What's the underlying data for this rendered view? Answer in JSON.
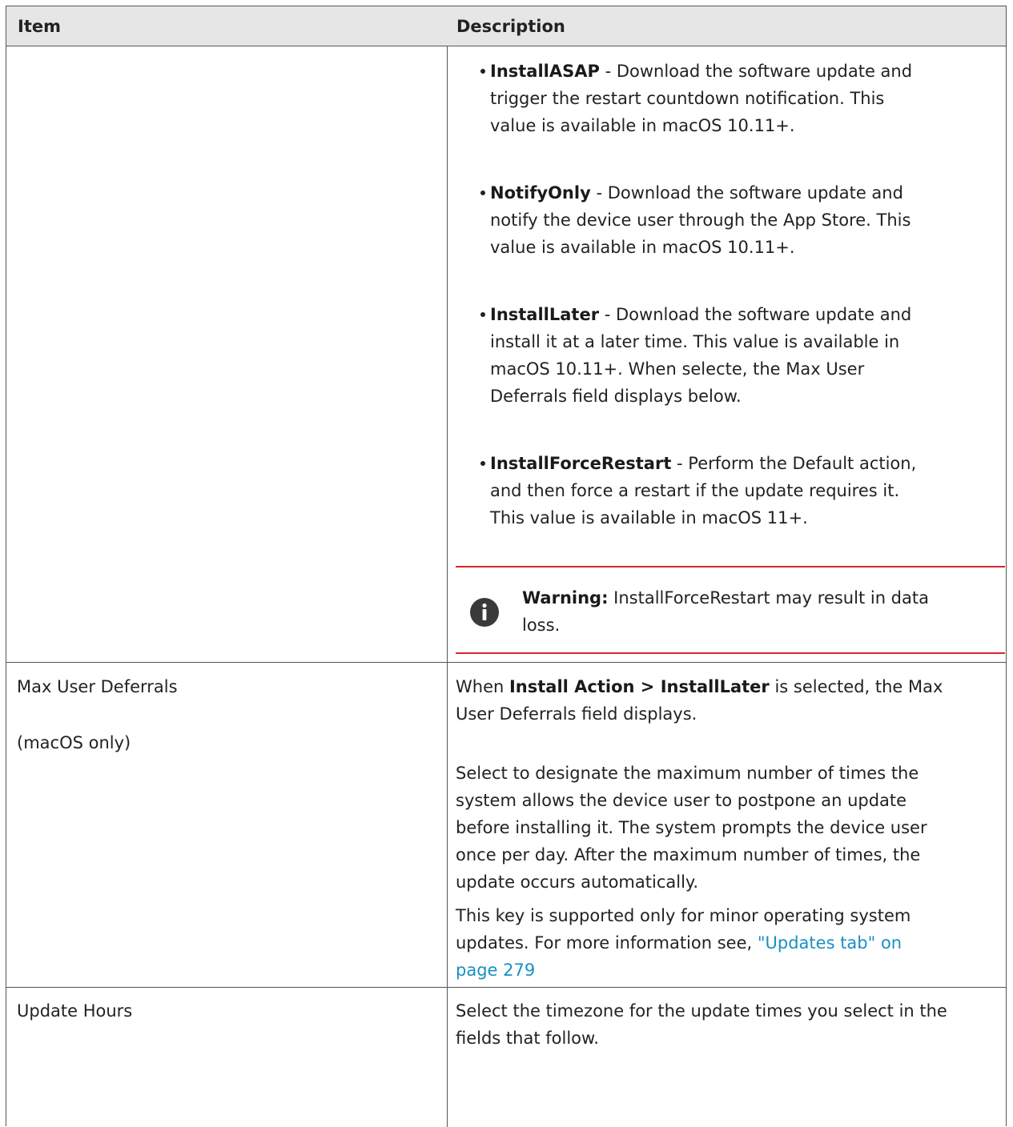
{
  "table": {
    "header": {
      "item": "Item",
      "description": "Description"
    },
    "install_action_options": [
      {
        "term": "InstallASAP",
        "sep": " - ",
        "desc_lines": [
          "Download the software update and",
          "trigger the restart countdown notification. This",
          "value is available in macOS 10.11+."
        ]
      },
      {
        "term": "NotifyOnly",
        "sep": " - ",
        "desc_lines": [
          "Download the software update and",
          "notify the device user through the App Store. This",
          "value is available in macOS 10.11+."
        ]
      },
      {
        "term": "InstallLater",
        "sep": " - ",
        "desc_lines": [
          "Download the software update and",
          "install it at a later time. This value is available in",
          "macOS 10.11+. When selecte, the Max User",
          "Deferrals field displays below."
        ]
      },
      {
        "term": "InstallForceRestart",
        "sep": " - ",
        "desc_lines": [
          "Perform the Default action,",
          "and then force a restart if the update requires it.",
          "This value is available in macOS 11+."
        ]
      }
    ],
    "warning": {
      "icon": "info-icon",
      "label": "Warning:",
      "line1": " InstallForceRestart may result in data",
      "line2": "loss."
    },
    "max_user_deferrals": {
      "item_line1": "Max User Deferrals",
      "item_line2": "(macOS only)",
      "p1_prefix": "When ",
      "p1_bold": "Install Action > InstallLater",
      "p1_suffix": " is selected, the Max",
      "p1_line2": "User Deferrals field displays.",
      "p2_lines": [
        "Select to designate the maximum number of times the",
        "system allows the device user to postpone an update",
        "before installing it. The system prompts the device user",
        "once per day. After the maximum number of times, the",
        "update occurs automatically."
      ],
      "p3_line1": "This key is supported only for minor operating system",
      "p3_line2_prefix": "updates. For more information see, ",
      "p3_link_part1": "\"Updates tab\" on",
      "p3_link_part2": "page 279"
    },
    "update_hours": {
      "item": "Update Hours",
      "desc_line1": "Select the timezone for the update times you select in the",
      "desc_line2": "fields that follow."
    },
    "colors": {
      "warning_rule": "#d9262a",
      "link": "#1a8fc5",
      "header_bg": "#e6e6e6"
    }
  }
}
